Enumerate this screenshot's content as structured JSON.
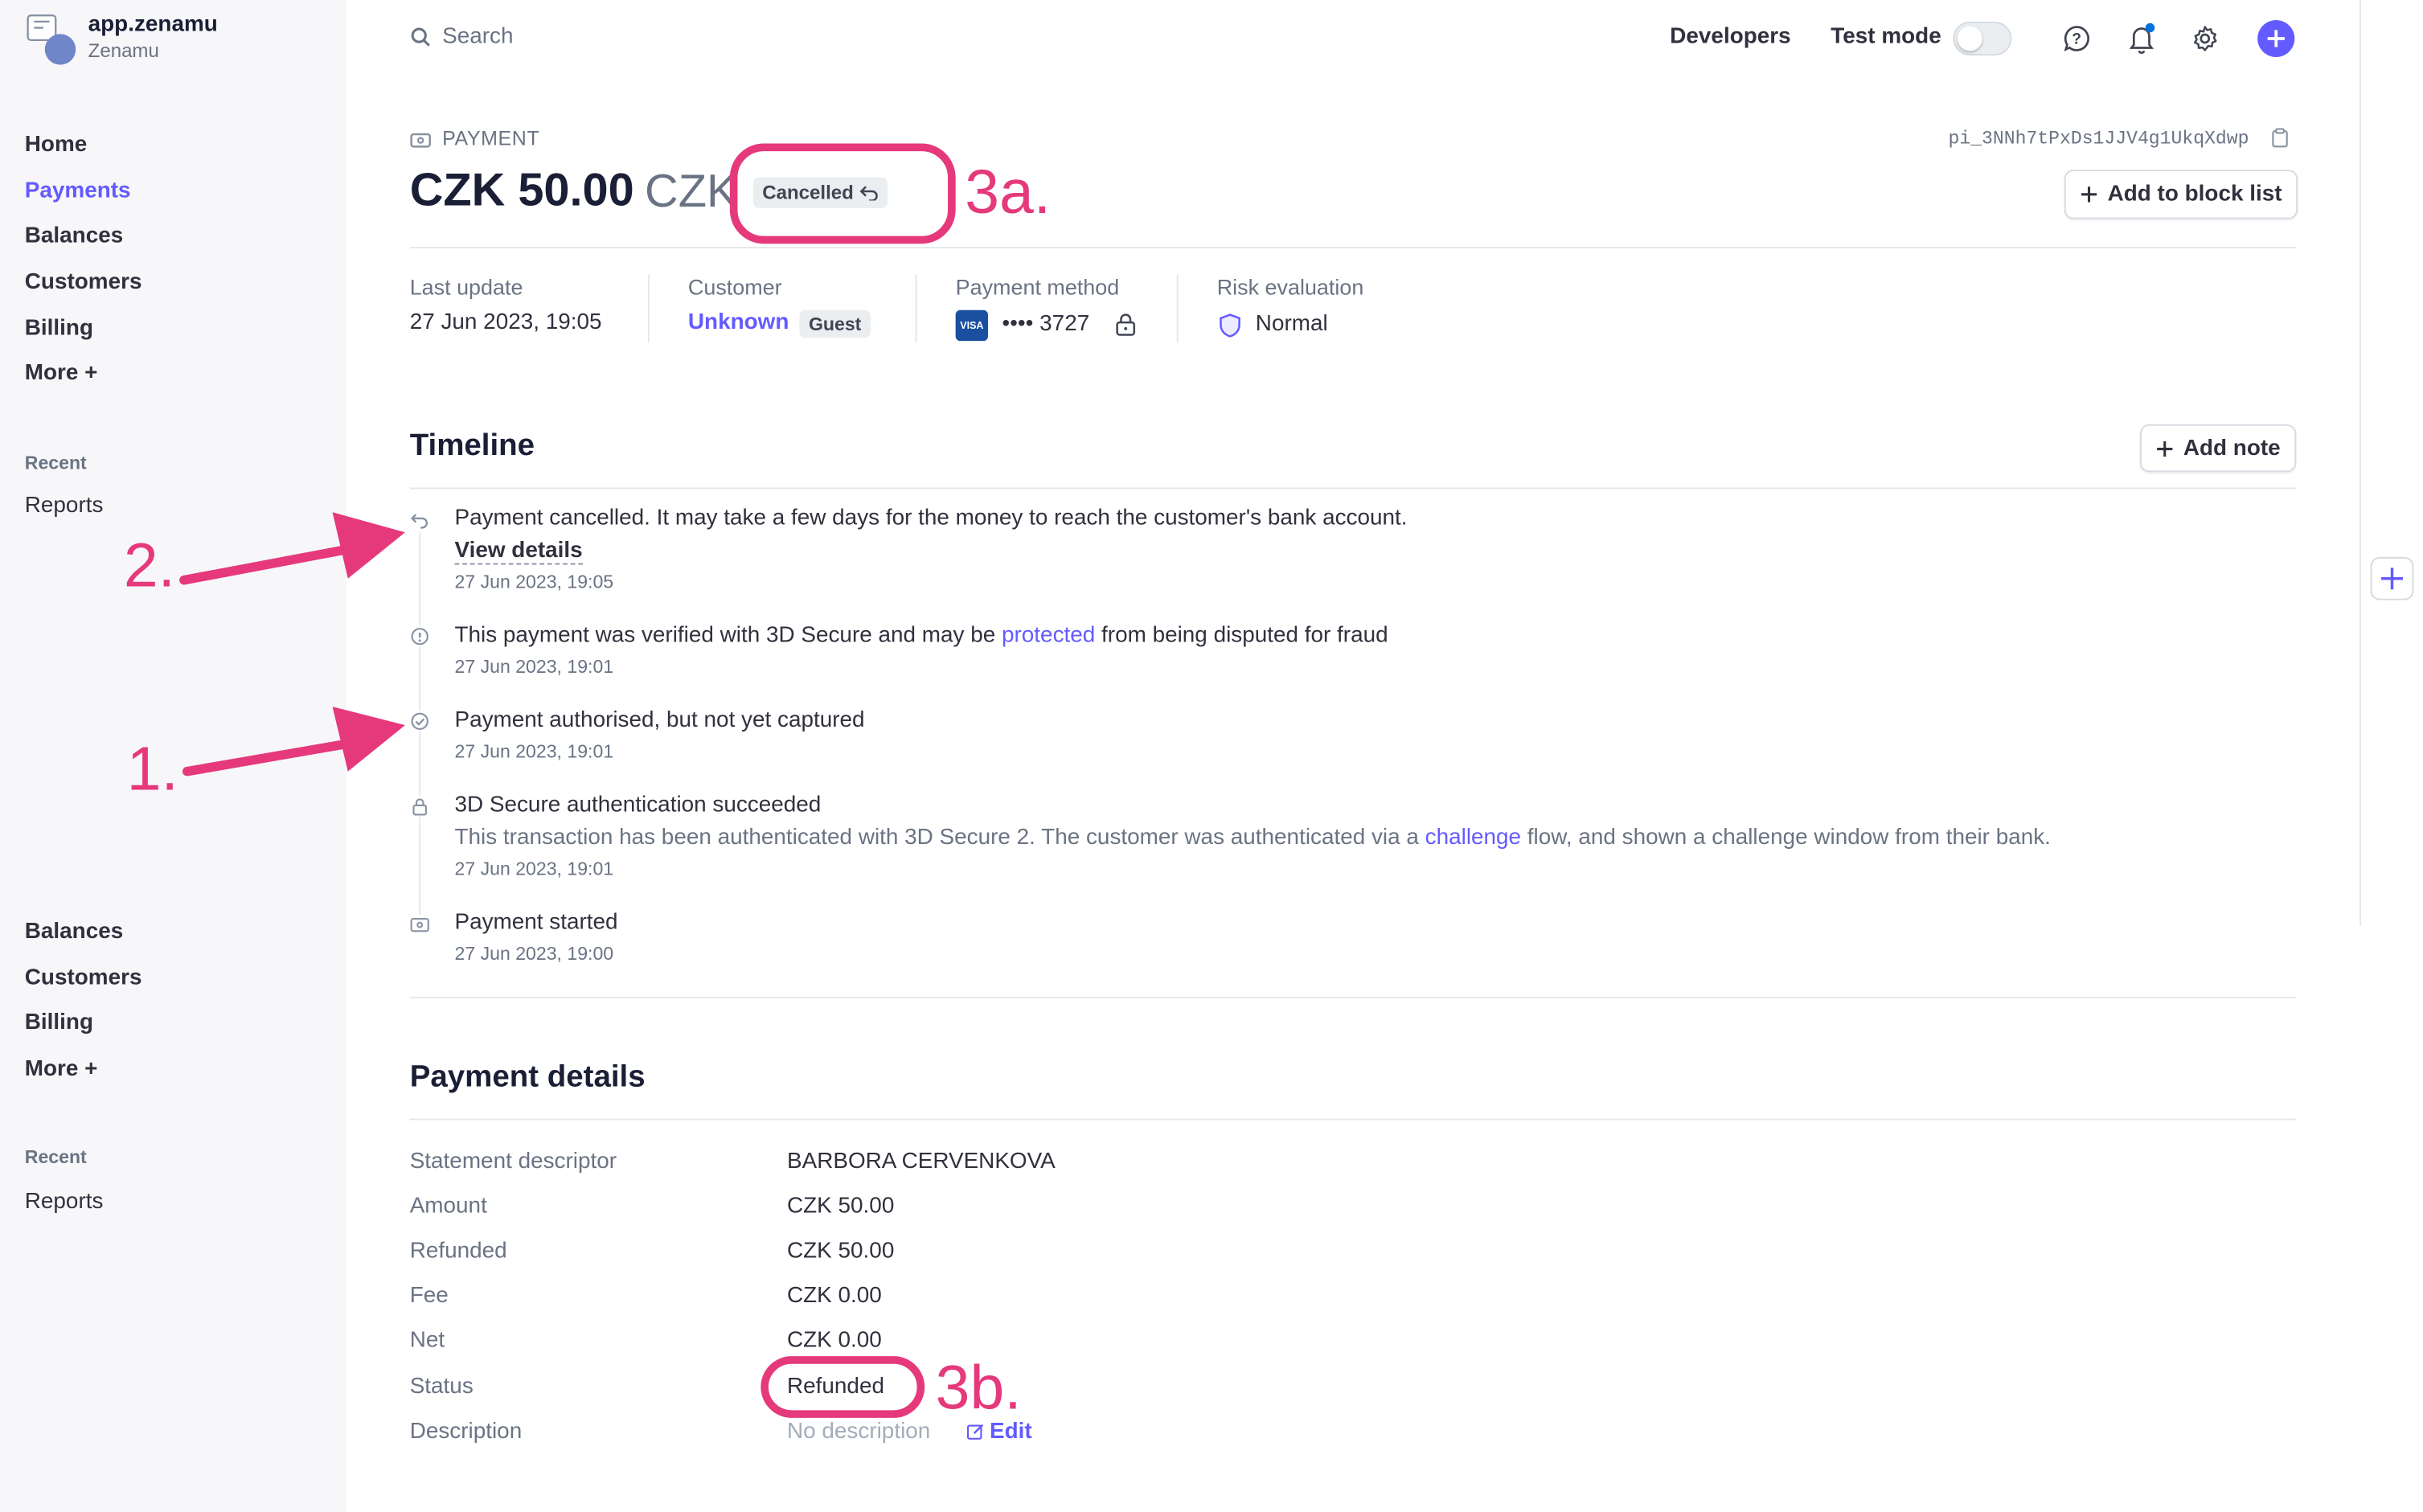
{
  "app": {
    "url": "app.zenamu",
    "account": "Zenamu"
  },
  "search": {
    "label": "Search"
  },
  "topbar": {
    "developers": "Developers",
    "test_mode": "Test mode"
  },
  "sidebar": {
    "items": [
      "Home",
      "Payments",
      "Balances",
      "Customers",
      "Billing",
      "More +"
    ],
    "recent_label": "Recent",
    "recent_items": [
      "Reports"
    ],
    "dup_items": [
      "Balances",
      "Customers",
      "Billing",
      "More +"
    ],
    "dup_recent_label": "Recent",
    "dup_recent_items": [
      "Reports"
    ]
  },
  "payment": {
    "kind_label": "PAYMENT",
    "id": "pi_3NNh7tPxDs1JJV4g1UkqXdwp",
    "amount": "CZK 50.00",
    "currency": "CZK",
    "status_badge": "Cancelled",
    "add_block_label": "Add to block list"
  },
  "summary": {
    "last_update_label": "Last update",
    "last_update_value": "27 Jun 2023, 19:05",
    "customer_label": "Customer",
    "customer_value": "Unknown",
    "customer_badge": "Guest",
    "payment_method_label": "Payment method",
    "card_brand": "VISA",
    "card_last4": "•••• 3727",
    "risk_label": "Risk evaluation",
    "risk_value": "Normal"
  },
  "timeline": {
    "title": "Timeline",
    "add_note_label": "Add note",
    "events": [
      {
        "text": "Payment cancelled. It may take a few days for the money to reach the customer's bank account.",
        "link": "View details",
        "date": "27 Jun 2023, 19:05",
        "icon": "undo-icon"
      },
      {
        "text_before": "This payment was verified with 3D Secure and may be ",
        "link": "protected",
        "text_after": " from being disputed for fraud",
        "date": "27 Jun 2023, 19:01",
        "icon": "info-icon"
      },
      {
        "text": "Payment authorised, but not yet captured",
        "date": "27 Jun 2023, 19:01",
        "icon": "check-circle-icon"
      },
      {
        "text": "3D Secure authentication succeeded",
        "sub_before": "This transaction has been authenticated with 3D Secure 2. The customer was authenticated via a ",
        "sub_link": "challenge",
        "sub_after": " flow, and shown a challenge window from their bank.",
        "date": "27 Jun 2023, 19:01",
        "icon": "lock-icon"
      },
      {
        "text": "Payment started",
        "date": "27 Jun 2023, 19:00",
        "icon": "payment-icon"
      }
    ]
  },
  "details": {
    "title": "Payment details",
    "rows": [
      {
        "label": "Statement descriptor",
        "value": "BARBORA CERVENKOVA"
      },
      {
        "label": "Amount",
        "value": "CZK 50.00"
      },
      {
        "label": "Refunded",
        "value": "CZK 50.00"
      },
      {
        "label": "Fee",
        "value": "CZK 0.00"
      },
      {
        "label": "Net",
        "value": "CZK 0.00"
      },
      {
        "label": "Status",
        "value": "Refunded"
      },
      {
        "label": "Description",
        "value": "No description"
      }
    ],
    "edit_label": "Edit"
  },
  "annotations": {
    "a1": "1.",
    "a2": "2.",
    "a3a": "3a.",
    "a3b": "3b."
  },
  "colors": {
    "accent": "#635bff",
    "annotation": "#e6397c",
    "text": "#30313d",
    "muted": "#6a7383"
  }
}
